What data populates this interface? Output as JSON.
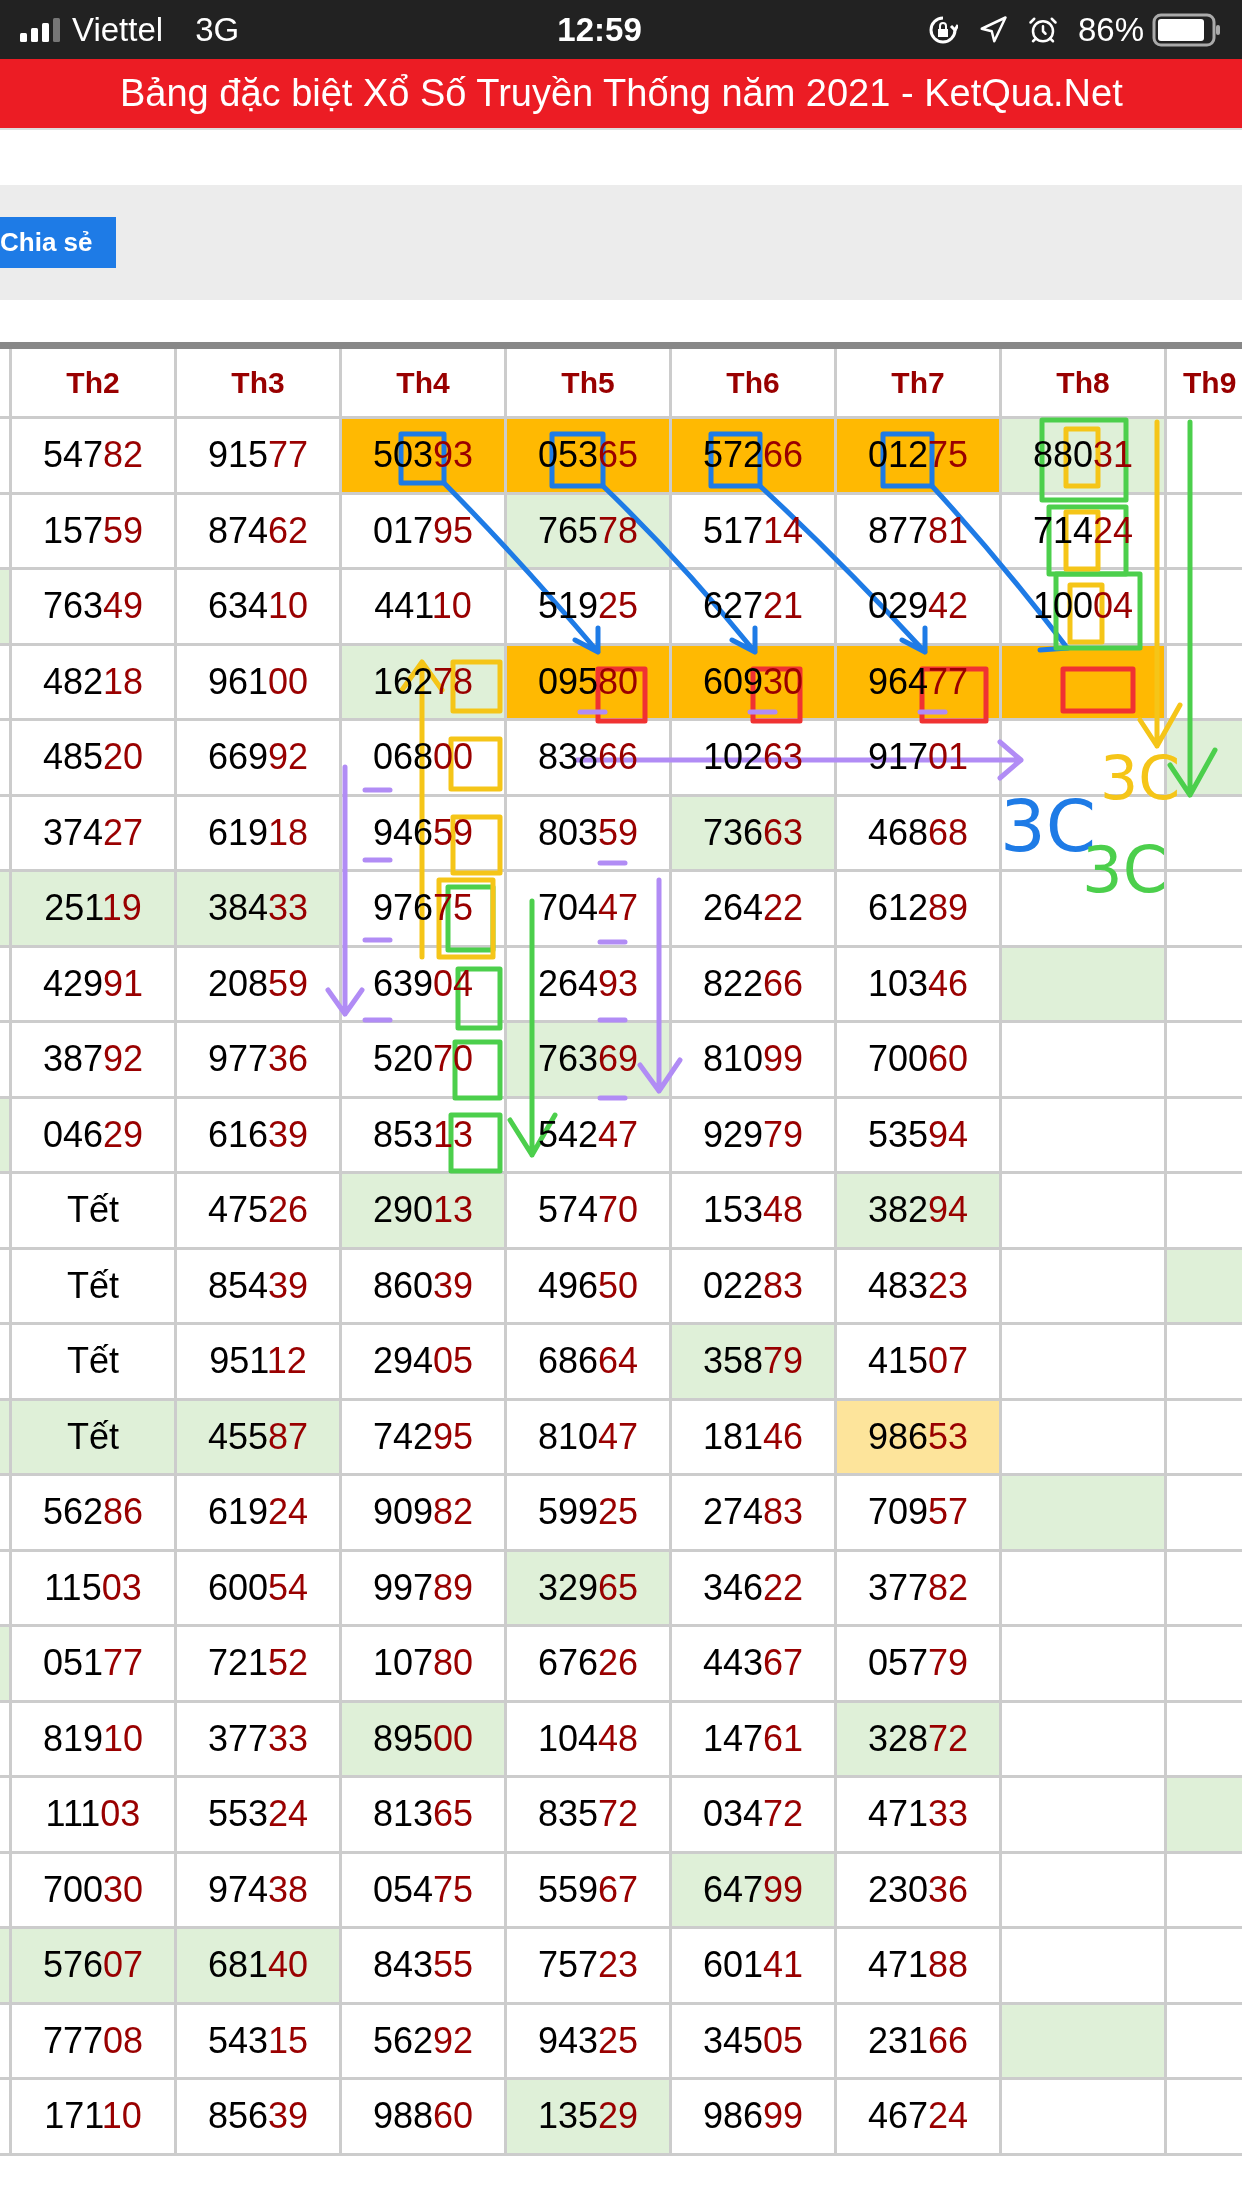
{
  "status_bar": {
    "carrier": "Viettel",
    "network": "3G",
    "time": "12:59",
    "battery": "86%"
  },
  "banner": {
    "title": "Bảng đặc biệt Xổ Số Truyền Thống năm 2021 - KetQua.Net"
  },
  "share_button": {
    "label": "Chia sẻ"
  },
  "table": {
    "columns": [
      "",
      "Th2",
      "Th3",
      "Th4",
      "Th5",
      "Th6",
      "Th7",
      "Th8",
      "Th9"
    ],
    "rows": [
      {
        "cells": [
          "",
          {
            "head": "547",
            "tail": "82"
          },
          {
            "head": "915",
            "tail": "77"
          },
          {
            "head": "503",
            "tail": "93",
            "color": "#ffb902"
          },
          {
            "head": "053",
            "tail": "65",
            "color": "#ffb902"
          },
          {
            "head": "572",
            "tail": "66",
            "color": "#ffb902"
          },
          {
            "head": "012",
            "tail": "75",
            "color": "#ffb902"
          },
          {
            "head": "880",
            "tail": "31",
            "color": "#dff0d8"
          },
          ""
        ]
      },
      {
        "cells": [
          "",
          {
            "head": "157",
            "tail": "59"
          },
          {
            "head": "874",
            "tail": "62"
          },
          {
            "head": "017",
            "tail": "95"
          },
          {
            "head": "765",
            "tail": "78",
            "color": "#dff0d8"
          },
          {
            "head": "517",
            "tail": "14"
          },
          {
            "head": "877",
            "tail": "81"
          },
          {
            "head": "714",
            "tail": "24"
          },
          ""
        ]
      },
      {
        "cells": [
          {
            "color": "#dff0d8"
          },
          {
            "head": "763",
            "tail": "49"
          },
          {
            "head": "634",
            "tail": "10"
          },
          {
            "head": "441",
            "tail": "10"
          },
          {
            "head": "519",
            "tail": "25"
          },
          {
            "head": "627",
            "tail": "21"
          },
          {
            "head": "029",
            "tail": "42"
          },
          {
            "head": "100",
            "tail": "04"
          },
          ""
        ]
      },
      {
        "cells": [
          "",
          {
            "head": "482",
            "tail": "18"
          },
          {
            "head": "961",
            "tail": "00"
          },
          {
            "head": "162",
            "tail": "78",
            "color": "#dff0d8"
          },
          {
            "head": "095",
            "tail": "80",
            "color": "#ffb902"
          },
          {
            "head": "609",
            "tail": "30",
            "color": "#ffb902"
          },
          {
            "head": "964",
            "tail": "77",
            "color": "#ffb902"
          },
          {
            "color": "#ffb902"
          },
          ""
        ]
      },
      {
        "cells": [
          "",
          {
            "head": "485",
            "tail": "20"
          },
          {
            "head": "669",
            "tail": "92"
          },
          {
            "head": "068",
            "tail": "00"
          },
          {
            "head": "838",
            "tail": "66"
          },
          {
            "head": "102",
            "tail": "63"
          },
          {
            "head": "917",
            "tail": "01"
          },
          "",
          {
            "color": "#dff0d8"
          }
        ]
      },
      {
        "cells": [
          "",
          {
            "head": "374",
            "tail": "27"
          },
          {
            "head": "619",
            "tail": "18"
          },
          {
            "head": "946",
            "tail": "59"
          },
          {
            "head": "803",
            "tail": "59"
          },
          {
            "head": "736",
            "tail": "63",
            "color": "#dff0d8"
          },
          {
            "head": "468",
            "tail": "68"
          },
          "",
          ""
        ]
      },
      {
        "cells": [
          {
            "color": "#dff0d8"
          },
          {
            "head": "251",
            "tail": "19",
            "color": "#dff0d8"
          },
          {
            "head": "384",
            "tail": "33",
            "color": "#dff0d8"
          },
          {
            "head": "976",
            "tail": "75"
          },
          {
            "head": "704",
            "tail": "47"
          },
          {
            "head": "264",
            "tail": "22"
          },
          {
            "head": "612",
            "tail": "89"
          },
          "",
          ""
        ]
      },
      {
        "cells": [
          "",
          {
            "head": "429",
            "tail": "91"
          },
          {
            "head": "208",
            "tail": "59"
          },
          {
            "head": "639",
            "tail": "04"
          },
          {
            "head": "264",
            "tail": "93"
          },
          {
            "head": "822",
            "tail": "66"
          },
          {
            "head": "103",
            "tail": "46"
          },
          {
            "color": "#dff0d8"
          },
          ""
        ]
      },
      {
        "cells": [
          "",
          {
            "head": "387",
            "tail": "92"
          },
          {
            "head": "977",
            "tail": "36"
          },
          {
            "head": "520",
            "tail": "70"
          },
          {
            "head": "763",
            "tail": "69",
            "color": "#dff0d8"
          },
          {
            "head": "810",
            "tail": "99"
          },
          {
            "head": "700",
            "tail": "60"
          },
          "",
          ""
        ]
      },
      {
        "cells": [
          {
            "color": "#dff0d8"
          },
          {
            "head": "046",
            "tail": "29"
          },
          {
            "head": "616",
            "tail": "39"
          },
          {
            "head": "853",
            "tail": "13"
          },
          {
            "head": "542",
            "tail": "47"
          },
          {
            "head": "929",
            "tail": "79"
          },
          {
            "head": "535",
            "tail": "94"
          },
          "",
          ""
        ]
      },
      {
        "cells": [
          "",
          {
            "head": "Tết"
          },
          {
            "head": "475",
            "tail": "26"
          },
          {
            "head": "290",
            "tail": "13",
            "color": "#dff0d8"
          },
          {
            "head": "574",
            "tail": "70"
          },
          {
            "head": "153",
            "tail": "48"
          },
          {
            "head": "382",
            "tail": "94",
            "color": "#dff0d8"
          },
          "",
          ""
        ]
      },
      {
        "cells": [
          "",
          {
            "head": "Tết"
          },
          {
            "head": "854",
            "tail": "39"
          },
          {
            "head": "860",
            "tail": "39"
          },
          {
            "head": "496",
            "tail": "50"
          },
          {
            "head": "022",
            "tail": "83"
          },
          {
            "head": "483",
            "tail": "23"
          },
          "",
          {
            "color": "#dff0d8"
          }
        ]
      },
      {
        "cells": [
          "",
          {
            "head": "Tết"
          },
          {
            "head": "951",
            "tail": "12"
          },
          {
            "head": "294",
            "tail": "05"
          },
          {
            "head": "686",
            "tail": "64"
          },
          {
            "head": "358",
            "tail": "79",
            "color": "#dff0d8"
          },
          {
            "head": "415",
            "tail": "07"
          },
          "",
          ""
        ]
      },
      {
        "cells": [
          {
            "color": "#dff0d8"
          },
          {
            "head": "Tết",
            "color": "#dff0d8"
          },
          {
            "head": "455",
            "tail": "87",
            "color": "#dff0d8"
          },
          {
            "head": "742",
            "tail": "95"
          },
          {
            "head": "810",
            "tail": "47"
          },
          {
            "head": "181",
            "tail": "46"
          },
          {
            "head": "986",
            "tail": "53",
            "color": "#fde49b"
          },
          "",
          ""
        ]
      },
      {
        "cells": [
          "",
          {
            "head": "562",
            "tail": "86"
          },
          {
            "head": "619",
            "tail": "24"
          },
          {
            "head": "909",
            "tail": "82"
          },
          {
            "head": "599",
            "tail": "25"
          },
          {
            "head": "274",
            "tail": "83"
          },
          {
            "head": "709",
            "tail": "57"
          },
          {
            "color": "#dff0d8"
          },
          ""
        ]
      },
      {
        "cells": [
          "",
          {
            "head": "115",
            "tail": "03"
          },
          {
            "head": "600",
            "tail": "54"
          },
          {
            "head": "997",
            "tail": "89"
          },
          {
            "head": "329",
            "tail": "65",
            "color": "#dff0d8"
          },
          {
            "head": "346",
            "tail": "22"
          },
          {
            "head": "377",
            "tail": "82"
          },
          "",
          ""
        ]
      },
      {
        "cells": [
          {
            "color": "#dff0d8"
          },
          {
            "head": "051",
            "tail": "77"
          },
          {
            "head": "721",
            "tail": "52"
          },
          {
            "head": "107",
            "tail": "80"
          },
          {
            "head": "676",
            "tail": "26"
          },
          {
            "head": "443",
            "tail": "67"
          },
          {
            "head": "057",
            "tail": "79"
          },
          "",
          ""
        ]
      },
      {
        "cells": [
          "",
          {
            "head": "819",
            "tail": "10"
          },
          {
            "head": "377",
            "tail": "33"
          },
          {
            "head": "895",
            "tail": "00",
            "color": "#dff0d8"
          },
          {
            "head": "104",
            "tail": "48"
          },
          {
            "head": "147",
            "tail": "61"
          },
          {
            "head": "328",
            "tail": "72",
            "color": "#dff0d8"
          },
          "",
          ""
        ]
      },
      {
        "cells": [
          "",
          {
            "head": "111",
            "tail": "03"
          },
          {
            "head": "553",
            "tail": "24"
          },
          {
            "head": "813",
            "tail": "65"
          },
          {
            "head": "835",
            "tail": "72"
          },
          {
            "head": "034",
            "tail": "72"
          },
          {
            "head": "471",
            "tail": "33"
          },
          "",
          {
            "color": "#dff0d8"
          }
        ]
      },
      {
        "cells": [
          "",
          {
            "head": "700",
            "tail": "30"
          },
          {
            "head": "974",
            "tail": "38"
          },
          {
            "head": "054",
            "tail": "75"
          },
          {
            "head": "559",
            "tail": "67"
          },
          {
            "head": "647",
            "tail": "99",
            "color": "#dff0d8"
          },
          {
            "head": "230",
            "tail": "36"
          },
          "",
          ""
        ]
      },
      {
        "cells": [
          {
            "color": "#dff0d8"
          },
          {
            "head": "576",
            "tail": "07",
            "color": "#dff0d8"
          },
          {
            "head": "681",
            "tail": "40",
            "color": "#dff0d8"
          },
          {
            "head": "843",
            "tail": "55"
          },
          {
            "head": "757",
            "tail": "23"
          },
          {
            "head": "601",
            "tail": "41"
          },
          {
            "head": "471",
            "tail": "88"
          },
          "",
          ""
        ]
      },
      {
        "cells": [
          "",
          {
            "head": "777",
            "tail": "08"
          },
          {
            "head": "543",
            "tail": "15"
          },
          {
            "head": "562",
            "tail": "92"
          },
          {
            "head": "943",
            "tail": "25"
          },
          {
            "head": "345",
            "tail": "05"
          },
          {
            "head": "231",
            "tail": "66"
          },
          {
            "color": "#dff0d8"
          },
          ""
        ]
      },
      {
        "cells": [
          "",
          {
            "head": "171",
            "tail": "10"
          },
          {
            "head": "856",
            "tail": "39"
          },
          {
            "head": "988",
            "tail": "60"
          },
          {
            "head": "135",
            "tail": "29",
            "color": "#dff0d8"
          },
          {
            "head": "986",
            "tail": "99"
          },
          {
            "head": "467",
            "tail": "24"
          },
          "",
          ""
        ]
      }
    ]
  },
  "annotations": {
    "labels": [
      {
        "text": "3C",
        "color": "#1e7be6"
      },
      {
        "text": "3C",
        "color": "#f5c518"
      },
      {
        "text": "3C",
        "color": "#4ccf4c"
      }
    ]
  }
}
